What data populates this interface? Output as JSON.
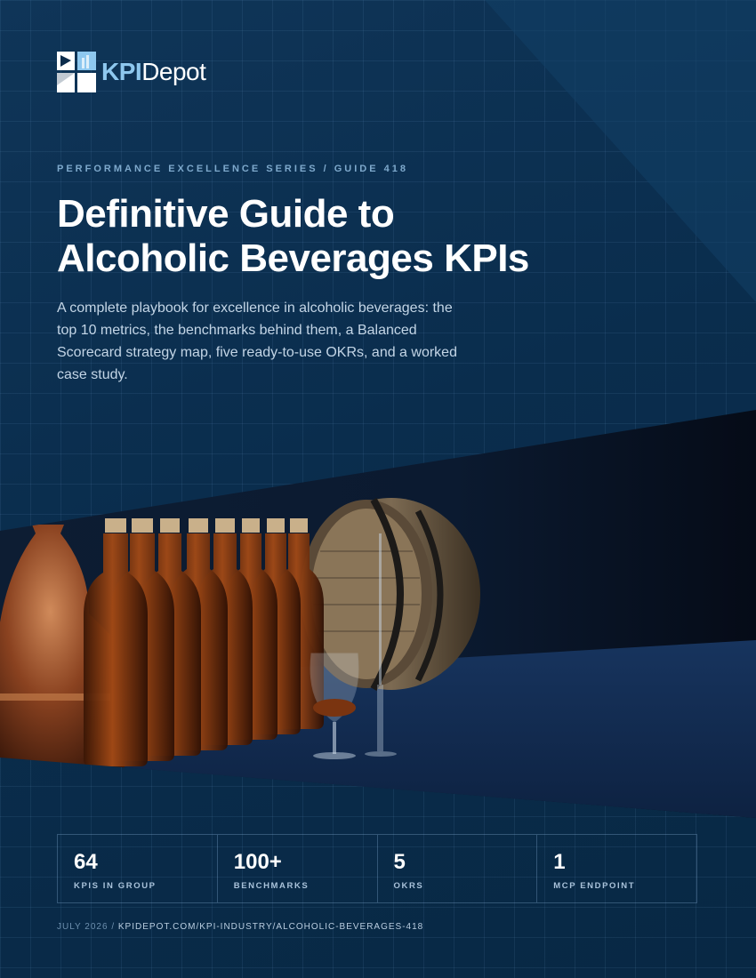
{
  "brand": {
    "kpi": "KPI",
    "depot": "Depot"
  },
  "series_label": "PERFORMANCE EXCELLENCE SERIES / GUIDE 418",
  "title": {
    "line1": "Definitive Guide to",
    "line2": "Alcoholic Beverages KPIs"
  },
  "subtitle": "A complete playbook for excellence in alcoholic beverages: the top 10 metrics, the benchmarks behind them, a Balanced Scorecard strategy map, five ready-to-use OKRs, and a worked case study.",
  "stats": [
    {
      "value": "64",
      "label": "KPIS IN GROUP"
    },
    {
      "value": "100+",
      "label": "BENCHMARKS"
    },
    {
      "value": "5",
      "label": "OKRS"
    },
    {
      "value": "1",
      "label": "MCP ENDPOINT"
    }
  ],
  "footer": {
    "date": "JULY 2026 / ",
    "url": "KPIDEPOT.COM/KPI-INDUSTRY/ALCOHOLIC-BEVERAGES-418"
  },
  "colors": {
    "background": "#0b2c4c",
    "accent": "#8ec8ef",
    "copper": "#a4542a",
    "whiskey": "#8a3c12"
  }
}
